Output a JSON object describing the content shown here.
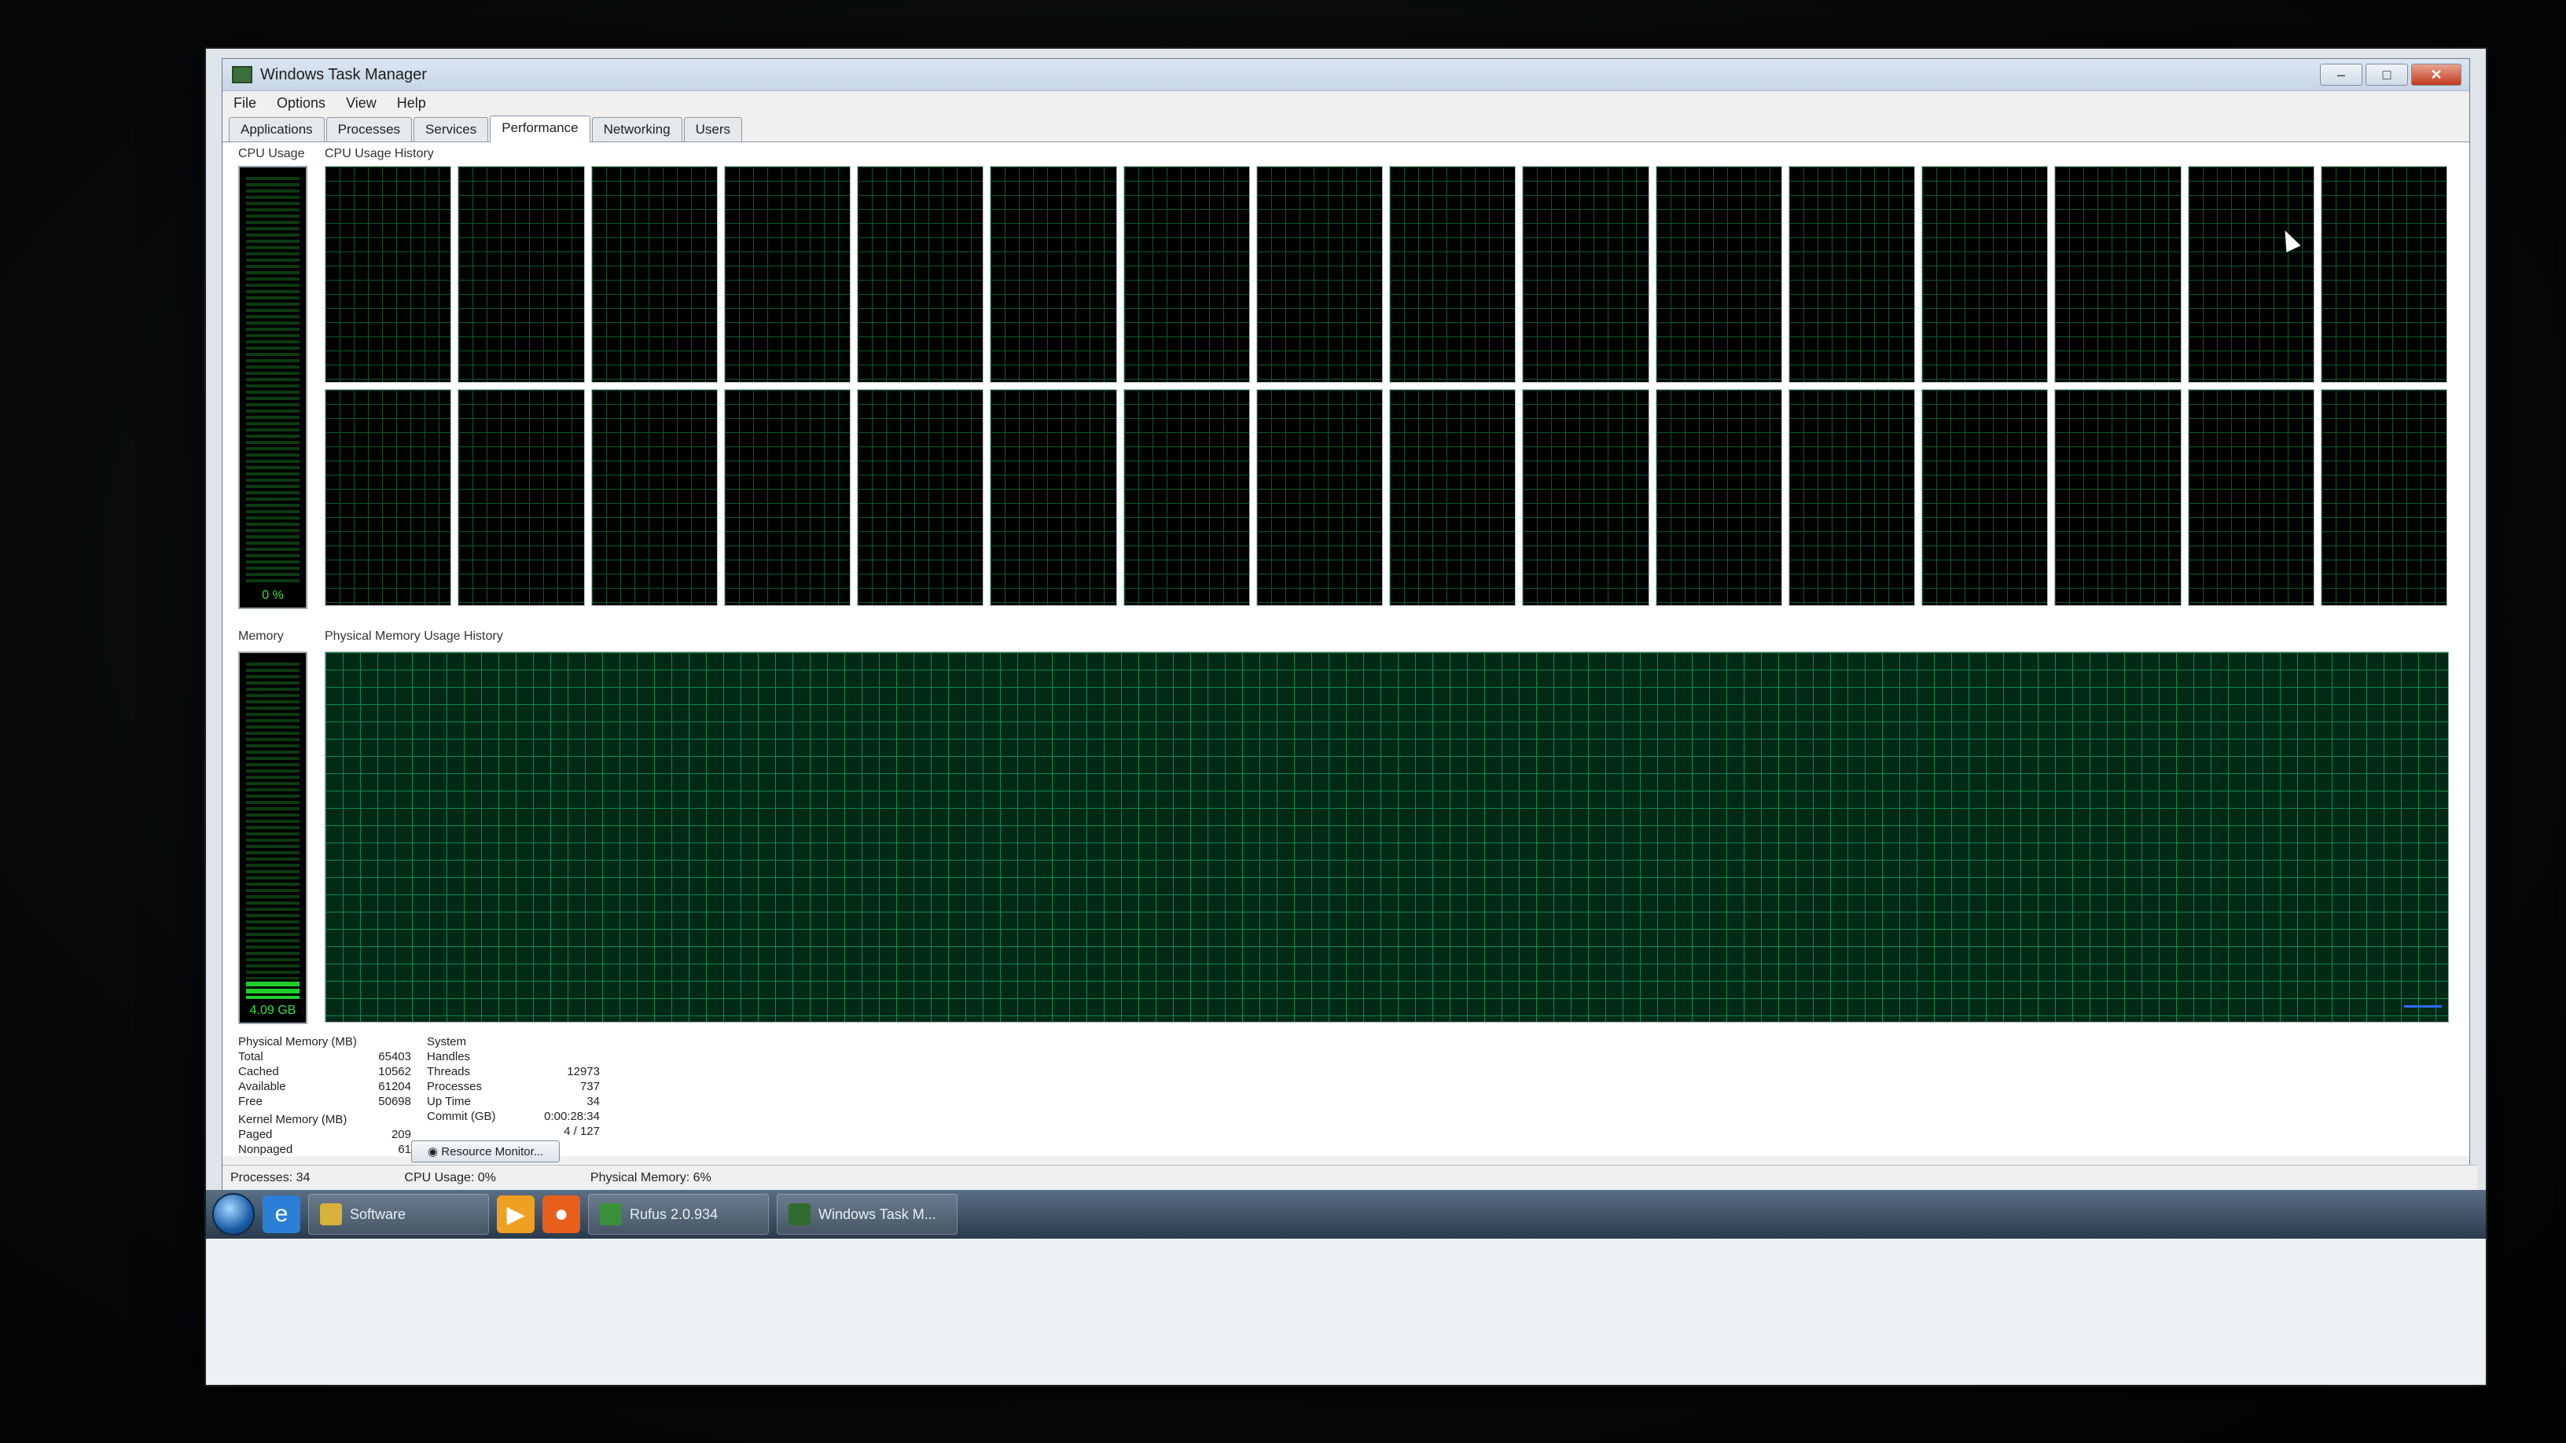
{
  "window": {
    "title": "Windows Task Manager",
    "controls": {
      "minimize": "–",
      "maximize": "□",
      "close": "✕"
    }
  },
  "menu": [
    "File",
    "Options",
    "View",
    "Help"
  ],
  "tabs": [
    {
      "label": "Applications",
      "active": false
    },
    {
      "label": "Processes",
      "active": false
    },
    {
      "label": "Services",
      "active": false
    },
    {
      "label": "Performance",
      "active": true
    },
    {
      "label": "Networking",
      "active": false
    },
    {
      "label": "Users",
      "active": false
    }
  ],
  "cpu": {
    "group_label": "CPU Usage",
    "history_label": "CPU Usage History",
    "meter_text": "0 %",
    "meter_level": 0.0,
    "core_count": 32
  },
  "memory": {
    "group_label": "Memory",
    "history_label": "Physical Memory Usage History",
    "meter_text": "4.09 GB",
    "meter_level": 0.06
  },
  "physical_memory": {
    "heading": "Physical Memory (MB)",
    "rows": [
      {
        "label": "Total",
        "value": "65403"
      },
      {
        "label": "Cached",
        "value": "10562"
      },
      {
        "label": "Available",
        "value": "61204"
      },
      {
        "label": "Free",
        "value": "50698"
      }
    ]
  },
  "kernel_memory": {
    "heading": "Kernel Memory (MB)",
    "rows": [
      {
        "label": "Paged",
        "value": "209"
      },
      {
        "label": "Nonpaged",
        "value": "61"
      }
    ]
  },
  "system": {
    "heading": "System",
    "rows": [
      {
        "label": "Handles",
        "value": ""
      },
      {
        "label": "Threads",
        "value": "12973"
      },
      {
        "label": "Processes",
        "value": "737"
      },
      {
        "label": "Up Time",
        "value": "34"
      },
      {
        "label": "Commit (GB)",
        "value": "0:00:28:34"
      },
      {
        "label": "",
        "value": "4 / 127"
      }
    ]
  },
  "resource_monitor_button": "Resource Monitor...",
  "statusbar": {
    "processes": "Processes: 34",
    "cpu_usage": "CPU Usage: 0%",
    "physical_memory": "Physical Memory: 6%"
  },
  "taskbar": {
    "items": [
      {
        "label": "Software",
        "color": "#d9b23a"
      },
      {
        "label": "Rufus 2.0.934",
        "color": "#3a8f3a"
      },
      {
        "label": "Windows Task M...",
        "color": "#2f6a2f"
      }
    ],
    "colors": {
      "ie": "#2b7fd6",
      "media": "#f0a020",
      "firefox": "#e85f1c"
    }
  }
}
